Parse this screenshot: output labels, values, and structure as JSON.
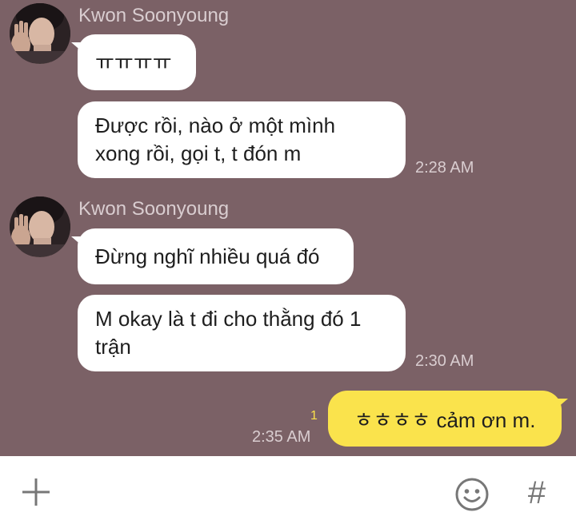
{
  "messages": [
    {
      "sender": "Kwon Soonyoung",
      "bubbles": [
        "ㅠㅠㅠㅠ",
        "Được rồi, nào ở một mình",
        "xong rồi, gọi t, t đón m"
      ],
      "time": "2:28 AM"
    },
    {
      "sender": "Kwon Soonyoung",
      "bubbles": [
        "Đừng nghĩ nhiều quá đó",
        "M okay là t đi cho thằng đó 1",
        "trận"
      ],
      "time": "2:30 AM"
    }
  ],
  "my_message": {
    "text": "ㅎㅎㅎㅎ cảm ơn m.",
    "unread_count": "1",
    "time": "2:35 AM"
  },
  "input_bar": {
    "left_icon": "plus-icon",
    "emoji_icon": "smiley-icon",
    "hash_icon": "hash-icon",
    "hash_glyph": "#"
  },
  "colors": {
    "chat_background": "#7b6166",
    "my_bubble": "#fae34c",
    "other_bubble": "#ffffff"
  }
}
